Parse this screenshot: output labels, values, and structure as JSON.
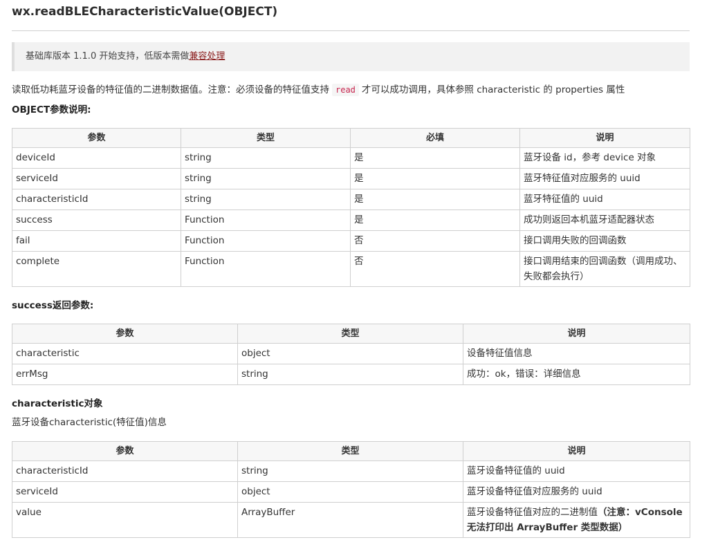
{
  "title": "wx.readBLECharacteristicValue(OBJECT)",
  "notice": {
    "text": "基础库版本 1.1.0 开始支持，低版本需做",
    "link": "兼容处理"
  },
  "description": {
    "before": "读取低功耗蓝牙设备的特征值的二进制数据值。注意：必须设备的特征值支持",
    "code": "read",
    "after": "才可以成功调用，具体参照 characteristic 的 properties 属性"
  },
  "object_params": {
    "heading": "OBJECT参数说明:",
    "headers": [
      "参数",
      "类型",
      "必填",
      "说明"
    ],
    "rows": [
      [
        "deviceId",
        "string",
        "是",
        "蓝牙设备 id，参考 device 对象"
      ],
      [
        "serviceId",
        "string",
        "是",
        "蓝牙特征值对应服务的 uuid"
      ],
      [
        "characteristicId",
        "string",
        "是",
        "蓝牙特征值的 uuid"
      ],
      [
        "success",
        "Function",
        "是",
        "成功则返回本机蓝牙适配器状态"
      ],
      [
        "fail",
        "Function",
        "否",
        "接口调用失败的回调函数"
      ],
      [
        "complete",
        "Function",
        "否",
        "接口调用结束的回调函数（调用成功、失败都会执行）"
      ]
    ]
  },
  "success_params": {
    "heading": "success返回参数:",
    "headers": [
      "参数",
      "类型",
      "说明"
    ],
    "rows": [
      [
        "characteristic",
        "object",
        "设备特征值信息"
      ],
      [
        "errMsg",
        "string",
        "成功：ok，错误：详细信息"
      ]
    ]
  },
  "characteristic_object": {
    "heading": "characteristic对象",
    "subtitle": "蓝牙设备characteristic(特征值)信息",
    "headers": [
      "参数",
      "类型",
      "说明"
    ],
    "rows": [
      [
        "characteristicId",
        "string",
        "蓝牙设备特征值的 uuid"
      ],
      [
        "serviceId",
        "object",
        "蓝牙设备特征值对应服务的 uuid"
      ],
      [
        "value",
        "ArrayBuffer",
        "蓝牙设备特征值对应的二进制值"
      ]
    ],
    "value_note": "（注意：vConsole 无法打印出 ArrayBuffer 类型数据）"
  }
}
